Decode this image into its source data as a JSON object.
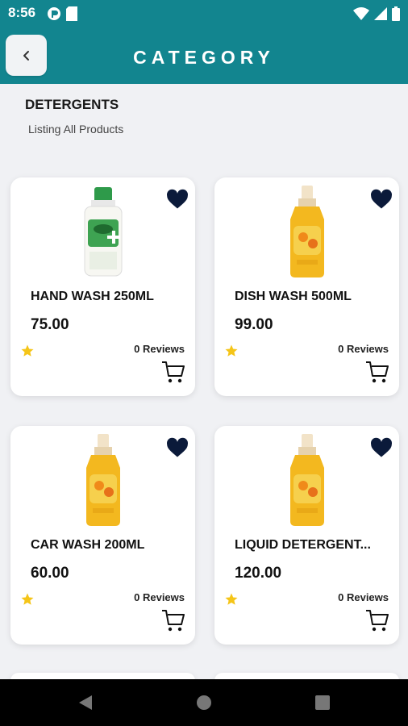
{
  "status_bar": {
    "time": "8:56"
  },
  "app_bar": {
    "title": "CATEGORY"
  },
  "category": {
    "title": "DETERGENTS",
    "subtitle": "Listing All Products"
  },
  "products": [
    {
      "name": "HAND WASH 250ML",
      "price": "75.00",
      "reviews": "0 Reviews",
      "image": "handwash-bottle"
    },
    {
      "name": "DISH WASH 500ML",
      "price": "99.00",
      "reviews": "0 Reviews",
      "image": "yellow-spray-bottle"
    },
    {
      "name": "CAR WASH 200ML",
      "price": "60.00",
      "reviews": "0 Reviews",
      "image": "yellow-spray-bottle"
    },
    {
      "name": "LIQUID DETERGENT...",
      "price": "120.00",
      "reviews": "0 Reviews",
      "image": "yellow-spray-bottle"
    }
  ],
  "colors": {
    "primary": "#12858f",
    "heart": "#0b1a3a",
    "star": "#f5c518",
    "background": "#f0f1f4"
  },
  "icons": {
    "favorite": "heart-icon",
    "rating": "star-icon",
    "cart": "cart-icon",
    "back": "chevron-left-icon"
  }
}
